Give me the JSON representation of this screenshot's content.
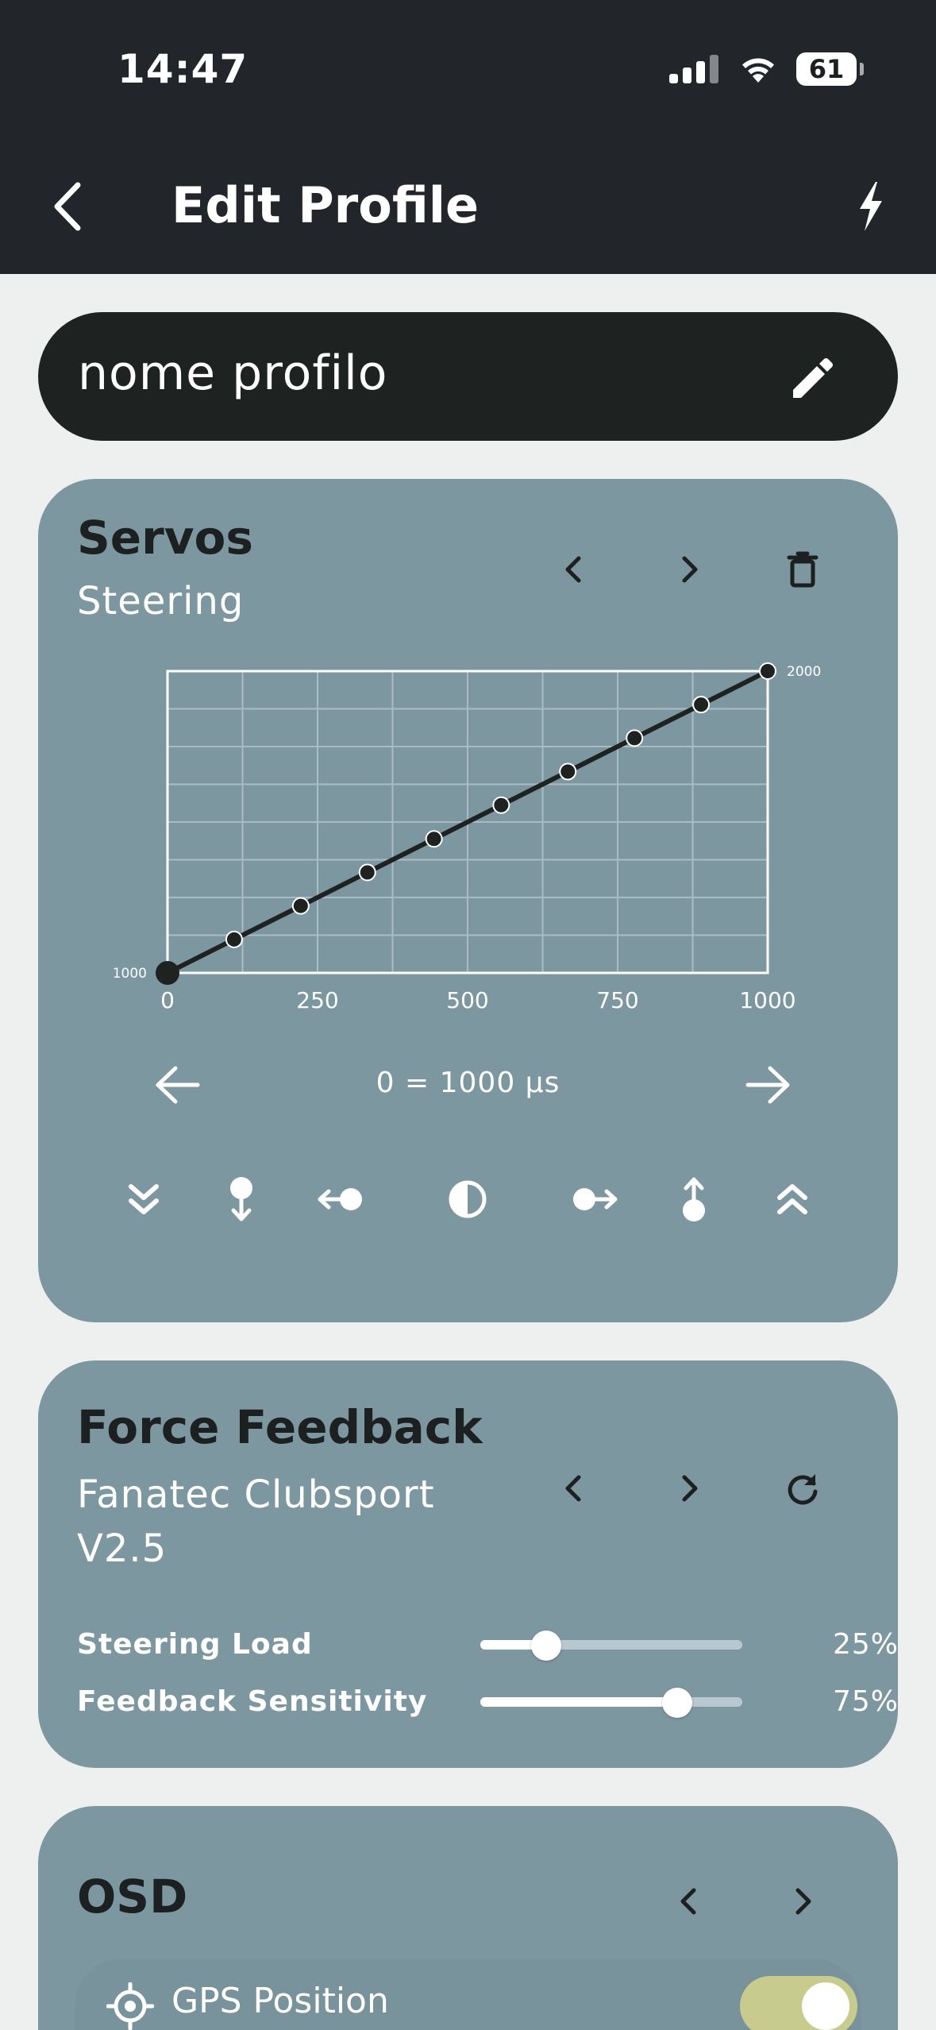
{
  "status_bar": {
    "time": "14:47",
    "battery": "61",
    "icons": [
      "cellular-signal-icon",
      "wifi-icon",
      "battery-icon"
    ]
  },
  "header": {
    "title": "Edit Profile",
    "back_icon": "chevron-left-icon",
    "action_icon": "bolt-icon"
  },
  "profile": {
    "name": "nome profilo",
    "edit_icon": "pencil-icon"
  },
  "servos": {
    "title": "Servos",
    "subtitle": "Steering",
    "icons": [
      "chevron-left-icon",
      "chevron-right-icon",
      "trash-icon"
    ],
    "readout": "0 = 1000 µs",
    "tools": [
      "double-chevron-down-icon",
      "pin-down-icon",
      "point-left-icon",
      "half-circle-icon",
      "point-right-icon",
      "pin-up-icon",
      "double-chevron-up-icon"
    ]
  },
  "chart_data": {
    "type": "line",
    "x": [
      0,
      111,
      222,
      333,
      444,
      556,
      667,
      778,
      889,
      1000
    ],
    "y": [
      1000,
      1111,
      1222,
      1333,
      1444,
      1556,
      1667,
      1778,
      1889,
      2000
    ],
    "xlim": [
      0,
      1000
    ],
    "ylim": [
      1000,
      2000
    ],
    "x_ticks": [
      "0",
      "250",
      "500",
      "750",
      "1000"
    ],
    "y_labels": [
      "1000",
      "2000"
    ],
    "grid": true,
    "selected_index": 0,
    "line_color": "#1e2221",
    "grid_color": "#a9bcc3"
  },
  "force_feedback": {
    "title": "Force Feedback",
    "subtitle_line1": "Fanatec Clubsport",
    "subtitle_line2": "V2.5",
    "icons": [
      "chevron-left-icon",
      "chevron-right-icon",
      "refresh-icon"
    ],
    "sliders": [
      {
        "label": "Steering Load",
        "value": 25,
        "display": "25%"
      },
      {
        "label": "Feedback Sensitivity",
        "value": 75,
        "display": "75%"
      }
    ]
  },
  "osd": {
    "title": "OSD",
    "icons": [
      "chevron-left-icon",
      "chevron-right-icon"
    ],
    "items": [
      {
        "label": "GPS Position",
        "icon": "crosshair-icon",
        "enabled": true
      }
    ]
  },
  "colors": {
    "dark_bg": "#22252a",
    "card": "#7d97a0",
    "page_bg": "#eef0ef",
    "toggle_on": "#c8cb8e"
  }
}
